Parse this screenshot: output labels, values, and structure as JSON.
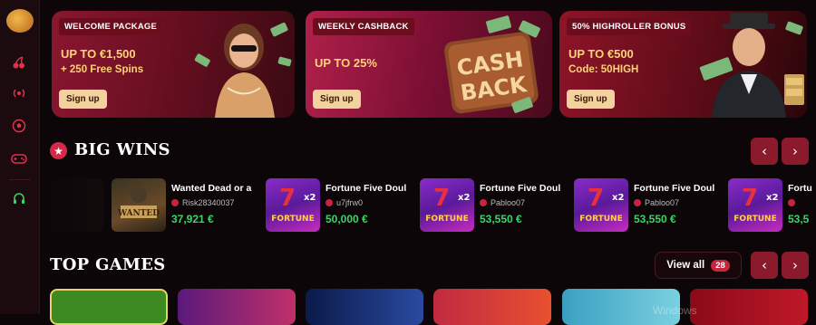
{
  "sidebar": {
    "icons": [
      "logo-icon",
      "cherry-icon",
      "live-icon",
      "soccer-ball-icon",
      "gamepad-icon",
      "headset-icon"
    ]
  },
  "banners": [
    {
      "tag": "WELCOME PACKAGE",
      "headline": "UP TO €1,500",
      "subline": "+ 250 Free Spins",
      "button": "Sign up"
    },
    {
      "tag": "WEEKLY CASHBACK",
      "headline": "UP TO 25%",
      "subline": "",
      "button": "Sign up",
      "art_text": [
        "CASH",
        "BACK"
      ]
    },
    {
      "tag": "50% HIGHROLLER BONUS",
      "headline": "UP TO €500",
      "subline": "Code: 50HIGH",
      "button": "Sign up"
    }
  ],
  "big_wins": {
    "title": "BIG WINS",
    "cards": [
      {
        "game": "Wanted Dead or a",
        "user": "Risk28340037",
        "amount": "37,921 €",
        "thumb": "wanted-thumb",
        "thumb_label": "WANTED"
      },
      {
        "game": "Fortune Five Doul",
        "user": "u7jfrw0",
        "amount": "50,000 €",
        "thumb": "fortune-thumb",
        "thumb_label": "FORTUNE"
      },
      {
        "game": "Fortune Five Doul",
        "user": "Pabloo07",
        "amount": "53,550 €",
        "thumb": "fortune-thumb",
        "thumb_label": "FORTUNE"
      },
      {
        "game": "Fortune Five Doul",
        "user": "Pabloo07",
        "amount": "53,550 €",
        "thumb": "fortune-thumb",
        "thumb_label": "FORTUNE"
      },
      {
        "game": "Fortu",
        "user": "",
        "amount": "53,5",
        "thumb": "fortune-thumb",
        "thumb_label": "FORTUNE"
      }
    ]
  },
  "top_games": {
    "title": "TOP GAMES",
    "view_all": "View all",
    "count": "28"
  },
  "nav": {
    "prev": "‹",
    "next": "›"
  },
  "watermark": "Windows",
  "colors": {
    "accent": "#c8243f",
    "gold": "#ffd27a",
    "win_green": "#3bd46a",
    "background": "#0d0608"
  }
}
